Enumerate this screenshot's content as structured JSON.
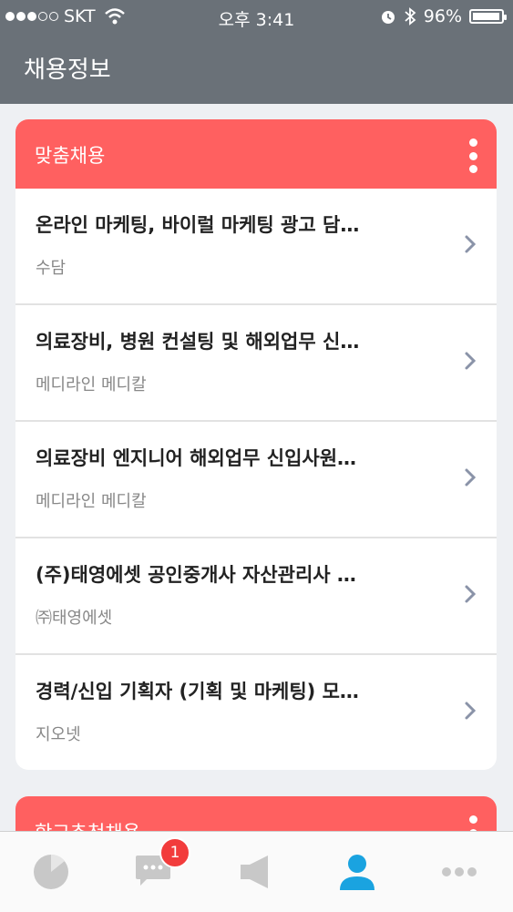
{
  "status_bar": {
    "carrier": "SKT",
    "time": "오후 3:41",
    "battery_percent": "96%",
    "battery_level": 0.96
  },
  "header": {
    "title": "채용정보"
  },
  "sections": [
    {
      "title": "맞춤채용",
      "items": [
        {
          "title": "온라인 마케팅, 바이럴 마케팅 광고 담…",
          "company": "수담"
        },
        {
          "title": "의료장비, 병원 컨설팅 및 해외업무 신…",
          "company": "메디라인 메디칼"
        },
        {
          "title": "의료장비 엔지니어 해외업무 신입사원…",
          "company": "메디라인 메디칼"
        },
        {
          "title": "(주)태영에셋 공인중개사 자산관리사 …",
          "company": "㈜태영에셋"
        },
        {
          "title": "경력/신입 기획자 (기획 및 마케팅) 모…",
          "company": "지오넷"
        }
      ]
    },
    {
      "title": "학교추천채용"
    }
  ],
  "tab_bar": {
    "tabs": [
      {
        "icon": "pie-chart-icon"
      },
      {
        "icon": "chat-bubble-icon",
        "badge": "1"
      },
      {
        "icon": "megaphone-icon"
      },
      {
        "icon": "person-icon",
        "active": true
      },
      {
        "icon": "more-icon"
      }
    ]
  },
  "colors": {
    "header_bg": "#6a7178",
    "card_header": "#ff6060",
    "active_tab": "#1aa3e0",
    "inactive_tab": "#c8c8c8",
    "badge": "#f23c3c"
  }
}
